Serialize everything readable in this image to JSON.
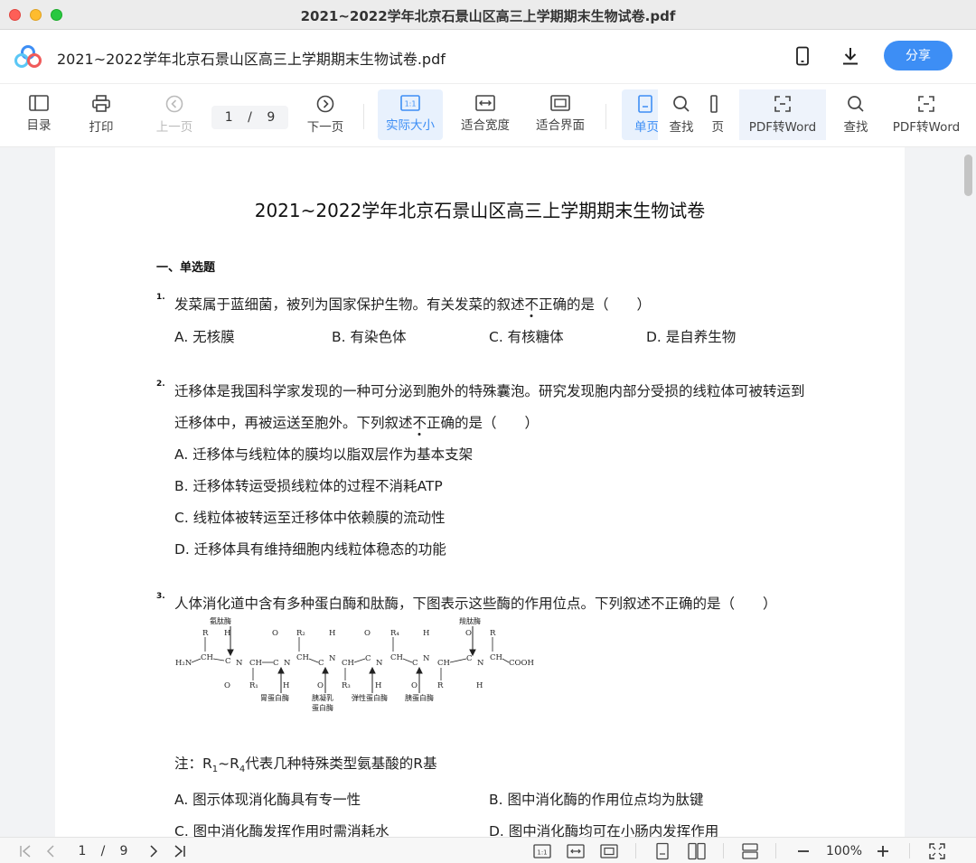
{
  "window": {
    "title": "2021~2022学年北京石景山区高三上学期期末生物试卷.pdf"
  },
  "header": {
    "file_name": "2021~2022学年北京石景山区高三上学期期末生物试卷.pdf",
    "share_label": "分享"
  },
  "toolbar": {
    "toc": "目录",
    "print": "打印",
    "prev": "上一页",
    "page_current": "1",
    "page_sep": "/",
    "page_total": "9",
    "next": "下一页",
    "actual_size": "实际大小",
    "fit_width": "适合宽度",
    "fit_page": "适合界面",
    "single": "单页",
    "find_overlay": "查找",
    "page_overlay": "页",
    "pdf_word_1": "PDF转Word",
    "find": "查找",
    "pdf_word_2": "PDF转Word"
  },
  "document": {
    "title": "2021~2022学年北京石景山区高三上学期期末生物试卷",
    "section": "一、单选题",
    "q1": {
      "num": "1.",
      "pre": "发菜属于蓝细菌，被列为国家保护生物。有关发菜的叙述",
      "emph": "不",
      "post": "正确的是（　　）",
      "options": [
        "A. 无核膜",
        "B. 有染色体",
        "C. 有核糖体",
        "D. 是自养生物"
      ]
    },
    "q2": {
      "num": "2.",
      "line1": "迁移体是我国科学家发现的一种可分泌到胞外的特殊囊泡。研究发现胞内部分受损的线粒体可被转运到",
      "line2_pre": "迁移体中，再被运送至胞外。下列叙述",
      "line2_emph": "不",
      "line2_post": "正确的是（　　）",
      "options": [
        "A. 迁移体与线粒体的膜均以脂双层作为基本支架",
        "B. 迁移体转运受损线粒体的过程不消耗ATP",
        "C. 线粒体被转运至迁移体中依赖膜的流动性",
        "D. 迁移体具有维持细胞内线粒体稳态的功能"
      ]
    },
    "q3": {
      "num": "3.",
      "text": "人体消化道中含有多种蛋白酶和肽酶，下图表示这些酶的作用位点。下列叙述不正确的是（　　）",
      "diagram": {
        "aminopeptidase": "氨肽酶",
        "carboxypeptidase": "羧肽酶",
        "pepsin": "胃蛋白酶",
        "chymotrypsin_1": "胰凝乳",
        "chymotrypsin_2": "蛋白酶",
        "elastase": "弹性蛋白酶",
        "trypsin": "胰蛋白酶",
        "h2n": "H₂N",
        "cooh": "COOH"
      },
      "note_pre": "注：R",
      "note_sub1": "1",
      "note_mid": "~R",
      "note_sub2": "4",
      "note_post": "代表几种特殊类型氨基酸的R基",
      "options": [
        "A. 图示体现消化酶具有专一性",
        "B. 图中消化酶的作用位点均为肽键",
        "C. 图中消化酶发挥作用时需消耗水",
        "D. 图中消化酶均可在小肠内发挥作用"
      ]
    }
  },
  "bottombar": {
    "page_current": "1",
    "page_sep": "/",
    "page_total": "9",
    "zoom": "100%"
  },
  "colors": {
    "accent": "#3d8ef5",
    "active_bg": "#e8f1fd"
  }
}
